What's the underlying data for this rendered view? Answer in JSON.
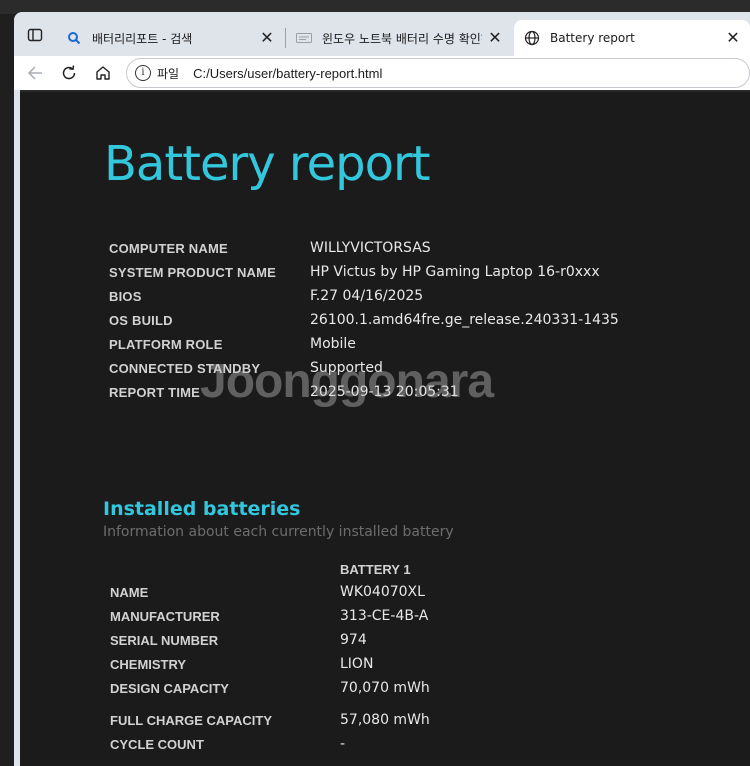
{
  "browser": {
    "tabs": [
      {
        "label": "배터리리포트 - 검색",
        "icon": "search-icon",
        "active": false
      },
      {
        "label": "윈도우 노트북 배터리 수명 확인하",
        "icon": "page-icon",
        "active": false
      },
      {
        "label": "Battery report",
        "icon": "globe-icon",
        "active": true
      }
    ],
    "close_glyph": "✕",
    "address": {
      "scheme_label": "파일",
      "url": "C:/Users/user/battery-report.html"
    },
    "accent_color": "#33c7dd"
  },
  "report": {
    "title": "Battery report",
    "system_info": [
      {
        "key": "COMPUTER NAME",
        "value": "WILLYVICTORSAS"
      },
      {
        "key": "SYSTEM PRODUCT NAME",
        "value": "HP Victus by HP Gaming Laptop 16-r0xxx"
      },
      {
        "key": "BIOS",
        "value": "F.27 04/16/2025"
      },
      {
        "key": "OS BUILD",
        "value": "26100.1.amd64fre.ge_release.240331-1435"
      },
      {
        "key": "PLATFORM ROLE",
        "value": "Mobile"
      },
      {
        "key": "CONNECTED STANDBY",
        "value": "Supported"
      },
      {
        "key": "REPORT TIME",
        "value": "2025-09-13  20:05:31"
      }
    ],
    "installed_batteries": {
      "title": "Installed batteries",
      "subtitle": "Information about each currently installed battery",
      "column_header": "BATTERY 1",
      "rows": [
        {
          "key": "NAME",
          "value": "WK04070XL"
        },
        {
          "key": "MANUFACTURER",
          "value": "313-CE-4B-A"
        },
        {
          "key": "SERIAL NUMBER",
          "value": "974"
        },
        {
          "key": "CHEMISTRY",
          "value": "LION"
        },
        {
          "key": "DESIGN CAPACITY",
          "value": "70,070 mWh"
        },
        {
          "key": "FULL CHARGE CAPACITY",
          "value": "57,080 mWh"
        },
        {
          "key": "CYCLE COUNT",
          "value": "-"
        }
      ]
    }
  },
  "watermark": "Joonggonara"
}
